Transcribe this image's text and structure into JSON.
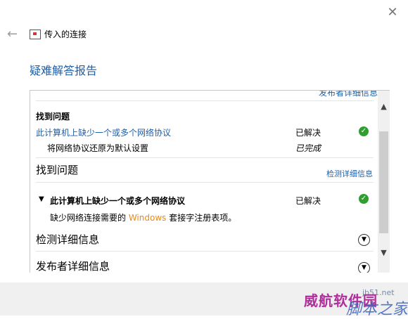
{
  "window": {
    "title": "传入的连接",
    "close_glyph": "✕",
    "back_glyph": "←"
  },
  "report": {
    "title": "疑难解答报告"
  },
  "panel": {
    "clipped_link": "发布者详细信息",
    "section1": {
      "title": "找到问题",
      "issue": {
        "label": "此计算机上缺少一个或多个网络协议",
        "status": "已解决",
        "status_icon": "check-icon",
        "sub_action": "将网络协议还原为默认设置",
        "sub_status": "已完成"
      }
    },
    "section2": {
      "title": "找到问题",
      "link": "检测详细信息",
      "issue": {
        "label": "此计算机上缺少一个或多个网络协议",
        "status": "已解决",
        "description_prefix": "缺少网络连接需要的 ",
        "description_brand": "Windows",
        "description_suffix": " 套接字注册表项。"
      }
    },
    "section3": {
      "title": "检测详细信息"
    },
    "section4": {
      "title": "发布者详细信息"
    }
  },
  "watermark": {
    "text1": "威航软件园",
    "text2": "脚本之家",
    "url": "jb51.net"
  },
  "colors": {
    "link": "#1f5fa6",
    "success": "#2f9e2f",
    "brand_orange": "#e8891a"
  }
}
